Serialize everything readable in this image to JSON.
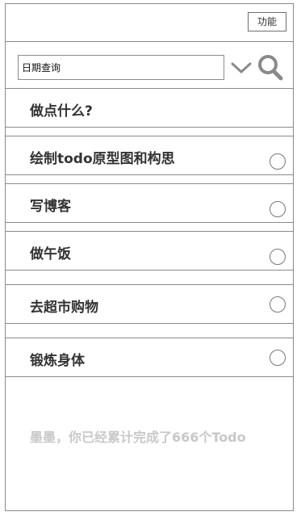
{
  "header": {
    "function_button_label": "功能"
  },
  "search": {
    "value": "日期查询",
    "placeholder": "日期查询"
  },
  "new_todo": {
    "text": "做点什么?"
  },
  "todos": [
    {
      "label": "绘制todo原型图和构思",
      "done": false
    },
    {
      "label": "写博客",
      "done": false
    },
    {
      "label": "做午饭",
      "done": false
    },
    {
      "label": "去超市购物",
      "done": false
    },
    {
      "label": "锻炼身体",
      "done": false
    }
  ],
  "footer": {
    "summary": "墨墨，你已经累计完成了666个Todo"
  },
  "icons": {
    "dropdown": "chevron-down-icon",
    "search": "search-icon",
    "checkbox": "circle-checkbox-icon"
  },
  "colors": {
    "border": "#8a8a8a",
    "text": "#333333",
    "summary_text": "#c8c8c8"
  }
}
